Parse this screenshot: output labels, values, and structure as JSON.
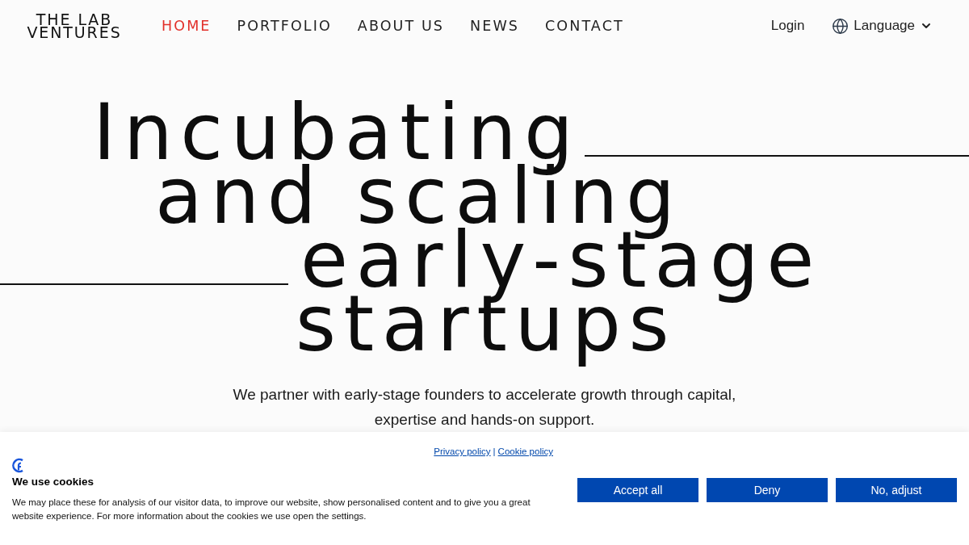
{
  "header": {
    "logo": {
      "line_1": "THE LAB",
      "line_2": "VENTURES"
    },
    "nav": [
      {
        "label": "HOME",
        "selected": true
      },
      {
        "label": "PORTFOLIO",
        "selected": false
      },
      {
        "label": "ABOUT US",
        "selected": false
      },
      {
        "label": "NEWS",
        "selected": false
      },
      {
        "label": "CONTACT",
        "selected": false
      }
    ],
    "login": "Login",
    "language": "Language"
  },
  "hero": {
    "headline": [
      "Incubating",
      "and scaling",
      "early-stage",
      "startups"
    ],
    "subtitle": "We partner with early-stage founders to accelerate growth through capital, expertise and hands-on support."
  },
  "cookie_banner": {
    "links": [
      "Privacy policy",
      "Cookie policy"
    ],
    "separator": "|",
    "title": "We use cookies",
    "text": "We may place these for analysis of our visitor data, to improve our website, show personalised content and to give you a great website experience. For more information about the cookies we use open the settings.",
    "buttons": [
      "Accept all",
      "Deny",
      "No, adjust"
    ]
  }
}
